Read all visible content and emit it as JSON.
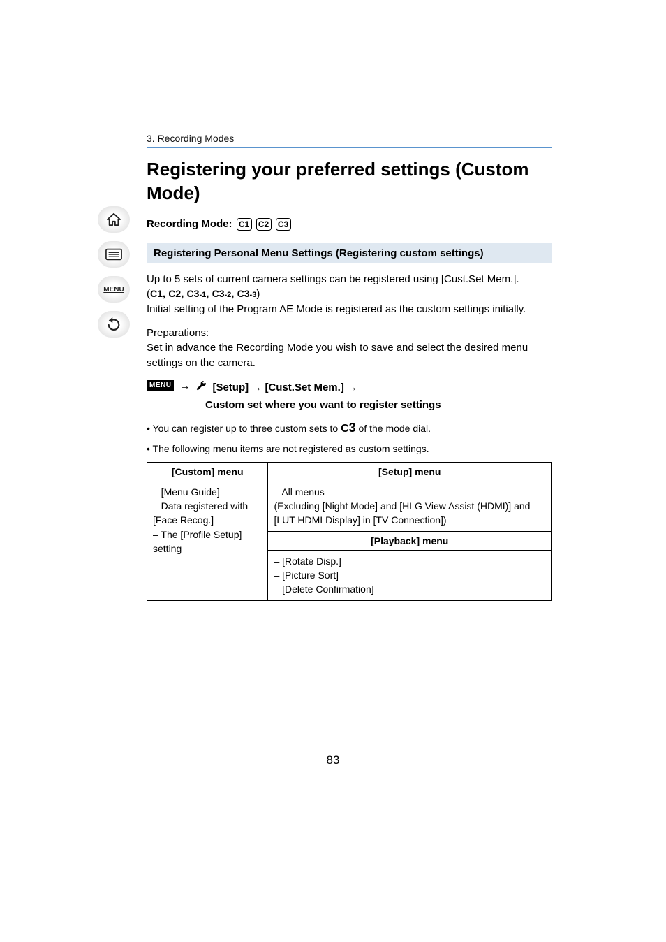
{
  "breadcrumb": "3. Recording Modes",
  "title": "Registering your preferred settings (Custom Mode)",
  "recording_mode_label": "Recording Mode:",
  "mode_badges": [
    "C1",
    "C2",
    "C3"
  ],
  "section_header": "Registering Personal Menu Settings (Registering custom settings)",
  "para1_a": "Up to 5 sets of current camera settings can be registered using [Cust.Set Mem.]. (",
  "para1_modes": "1, 2, 3-1, 3-2, 3-3",
  "para1_b": ")",
  "para1_line2": "Initial setting of the Program AE Mode is registered as the custom settings initially.",
  "prep_label": "Preparations:",
  "prep_text": "Set in advance the Recording Mode you wish to save and select the desired menu settings on the camera.",
  "menu_badge": "MENU",
  "arrow": "→",
  "menu_path_1": "[Setup]",
  "menu_path_2": "[Cust.Set Mem.]",
  "menu_path_line2": "Custom set where you want to register settings",
  "bullet1_a": "• You can register up to three custom sets to ",
  "bullet1_c3": "C3",
  "bullet1_b": " of the mode dial.",
  "bullet2": "• The following menu items are not registered as custom settings.",
  "table": {
    "head_custom": "[Custom] menu",
    "head_setup": "[Setup] menu",
    "head_playback": "[Playback] menu",
    "custom_items": "– [Menu Guide]\n– Data registered with [Face Recog.]\n– The [Profile Setup] setting",
    "setup_items": "– All menus\n(Excluding [Night Mode] and [HLG View Assist (HDMI)] and [LUT HDMI Display] in [TV Connection])",
    "playback_items": "– [Rotate Disp.]\n– [Picture Sort]\n– [Delete Confirmation]"
  },
  "page_number": "83",
  "sidebar": {
    "home": "home-icon",
    "toc": "toc-icon",
    "menu": "MENU",
    "back": "back-icon"
  }
}
